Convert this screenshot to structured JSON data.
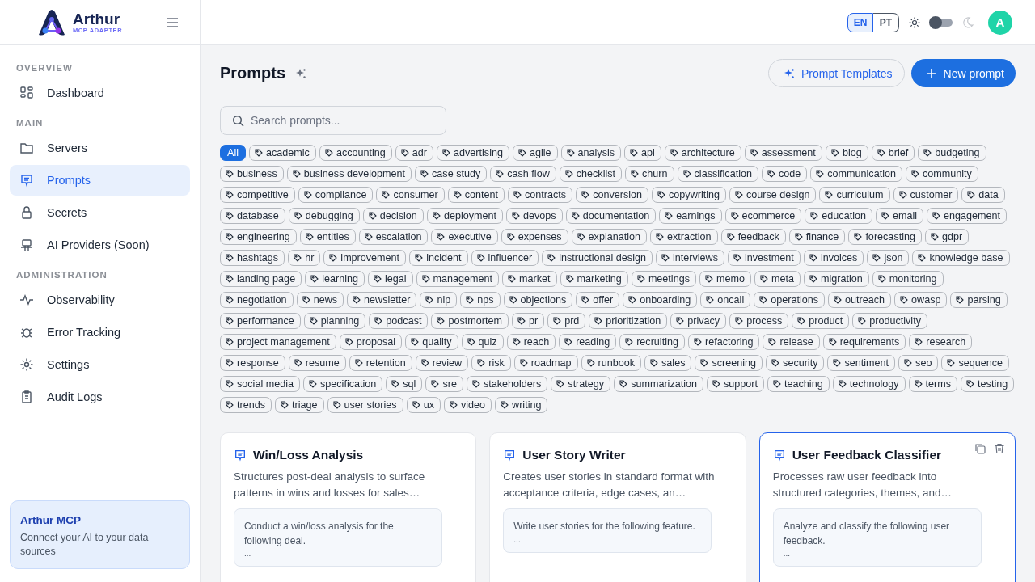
{
  "brand": {
    "name": "Arthur",
    "subtitle": "MCP ADAPTER"
  },
  "sidebar": {
    "sections": [
      {
        "title": "OVERVIEW",
        "items": [
          {
            "label": "Dashboard",
            "selected": false
          }
        ]
      },
      {
        "title": "MAIN",
        "items": [
          {
            "label": "Servers",
            "selected": false
          },
          {
            "label": "Prompts",
            "selected": true
          },
          {
            "label": "Secrets",
            "selected": false
          },
          {
            "label": "AI Providers (Soon)",
            "selected": false
          }
        ]
      },
      {
        "title": "ADMINISTRATION",
        "items": [
          {
            "label": "Observability",
            "selected": false
          },
          {
            "label": "Error Tracking",
            "selected": false
          },
          {
            "label": "Settings",
            "selected": false
          },
          {
            "label": "Audit Logs",
            "selected": false
          }
        ]
      }
    ],
    "promo": {
      "title": "Arthur MCP",
      "text": "Connect your AI to your data sources"
    }
  },
  "header": {
    "languages": [
      {
        "label": "EN",
        "selected": true
      },
      {
        "label": "PT",
        "selected": false
      }
    ],
    "dark_mode": false,
    "avatar": "A"
  },
  "page": {
    "title": "Prompts",
    "templates_button": "Prompt Templates",
    "new_button": "New prompt",
    "search": {
      "placeholder": "Search prompts..."
    }
  },
  "filters": [
    {
      "kind": "all",
      "label": "All",
      "selected": true
    },
    {
      "kind": "tag",
      "label": "academic",
      "selected": false
    },
    {
      "kind": "tag",
      "label": "accounting",
      "selected": false
    },
    {
      "kind": "tag",
      "label": "adr",
      "selected": false
    },
    {
      "kind": "tag",
      "label": "advertising",
      "selected": false
    },
    {
      "kind": "tag",
      "label": "agile",
      "selected": false
    },
    {
      "kind": "tag",
      "label": "analysis",
      "selected": false
    },
    {
      "kind": "tag",
      "label": "api",
      "selected": false
    },
    {
      "kind": "tag",
      "label": "architecture",
      "selected": false
    },
    {
      "kind": "tag",
      "label": "assessment",
      "selected": false
    },
    {
      "kind": "tag",
      "label": "blog",
      "selected": false
    },
    {
      "kind": "tag",
      "label": "brief",
      "selected": false
    },
    {
      "kind": "tag",
      "label": "budgeting",
      "selected": false
    },
    {
      "kind": "tag",
      "label": "business",
      "selected": false
    },
    {
      "kind": "tag",
      "label": "business development",
      "selected": false
    },
    {
      "kind": "tag",
      "label": "case study",
      "selected": false
    },
    {
      "kind": "tag",
      "label": "cash flow",
      "selected": false
    },
    {
      "kind": "tag",
      "label": "checklist",
      "selected": false
    },
    {
      "kind": "tag",
      "label": "churn",
      "selected": false
    },
    {
      "kind": "tag",
      "label": "classification",
      "selected": false
    },
    {
      "kind": "tag",
      "label": "code",
      "selected": false
    },
    {
      "kind": "tag",
      "label": "communication",
      "selected": false
    },
    {
      "kind": "tag",
      "label": "community",
      "selected": false
    },
    {
      "kind": "tag",
      "label": "competitive",
      "selected": false
    },
    {
      "kind": "tag",
      "label": "compliance",
      "selected": false
    },
    {
      "kind": "tag",
      "label": "consumer",
      "selected": false
    },
    {
      "kind": "tag",
      "label": "content",
      "selected": false
    },
    {
      "kind": "tag",
      "label": "contracts",
      "selected": false
    },
    {
      "kind": "tag",
      "label": "conversion",
      "selected": false
    },
    {
      "kind": "tag",
      "label": "copywriting",
      "selected": false
    },
    {
      "kind": "tag",
      "label": "course design",
      "selected": false
    },
    {
      "kind": "tag",
      "label": "curriculum",
      "selected": false
    },
    {
      "kind": "tag",
      "label": "customer",
      "selected": false
    },
    {
      "kind": "tag",
      "label": "data",
      "selected": false
    },
    {
      "kind": "tag",
      "label": "database",
      "selected": false
    },
    {
      "kind": "tag",
      "label": "debugging",
      "selected": false
    },
    {
      "kind": "tag",
      "label": "decision",
      "selected": false
    },
    {
      "kind": "tag",
      "label": "deployment",
      "selected": false
    },
    {
      "kind": "tag",
      "label": "devops",
      "selected": false
    },
    {
      "kind": "tag",
      "label": "documentation",
      "selected": false
    },
    {
      "kind": "tag",
      "label": "earnings",
      "selected": false
    },
    {
      "kind": "tag",
      "label": "ecommerce",
      "selected": false
    },
    {
      "kind": "tag",
      "label": "education",
      "selected": false
    },
    {
      "kind": "tag",
      "label": "email",
      "selected": false
    },
    {
      "kind": "tag",
      "label": "engagement",
      "selected": false
    },
    {
      "kind": "tag",
      "label": "engineering",
      "selected": false
    },
    {
      "kind": "tag",
      "label": "entities",
      "selected": false
    },
    {
      "kind": "tag",
      "label": "escalation",
      "selected": false
    },
    {
      "kind": "tag",
      "label": "executive",
      "selected": false
    },
    {
      "kind": "tag",
      "label": "expenses",
      "selected": false
    },
    {
      "kind": "tag",
      "label": "explanation",
      "selected": false
    },
    {
      "kind": "tag",
      "label": "extraction",
      "selected": false
    },
    {
      "kind": "tag",
      "label": "feedback",
      "selected": false
    },
    {
      "kind": "tag",
      "label": "finance",
      "selected": false
    },
    {
      "kind": "tag",
      "label": "forecasting",
      "selected": false
    },
    {
      "kind": "tag",
      "label": "gdpr",
      "selected": false
    },
    {
      "kind": "tag",
      "label": "hashtags",
      "selected": false
    },
    {
      "kind": "tag",
      "label": "hr",
      "selected": false
    },
    {
      "kind": "tag",
      "label": "improvement",
      "selected": false
    },
    {
      "kind": "tag",
      "label": "incident",
      "selected": false
    },
    {
      "kind": "tag",
      "label": "influencer",
      "selected": false
    },
    {
      "kind": "tag",
      "label": "instructional design",
      "selected": false
    },
    {
      "kind": "tag",
      "label": "interviews",
      "selected": false
    },
    {
      "kind": "tag",
      "label": "investment",
      "selected": false
    },
    {
      "kind": "tag",
      "label": "invoices",
      "selected": false
    },
    {
      "kind": "tag",
      "label": "json",
      "selected": false
    },
    {
      "kind": "tag",
      "label": "knowledge base",
      "selected": false
    },
    {
      "kind": "tag",
      "label": "landing page",
      "selected": false
    },
    {
      "kind": "tag",
      "label": "learning",
      "selected": false
    },
    {
      "kind": "tag",
      "label": "legal",
      "selected": false
    },
    {
      "kind": "tag",
      "label": "management",
      "selected": false
    },
    {
      "kind": "tag",
      "label": "market",
      "selected": false
    },
    {
      "kind": "tag",
      "label": "marketing",
      "selected": false
    },
    {
      "kind": "tag",
      "label": "meetings",
      "selected": false
    },
    {
      "kind": "tag",
      "label": "memo",
      "selected": false
    },
    {
      "kind": "tag",
      "label": "meta",
      "selected": false
    },
    {
      "kind": "tag",
      "label": "migration",
      "selected": false
    },
    {
      "kind": "tag",
      "label": "monitoring",
      "selected": false
    },
    {
      "kind": "tag",
      "label": "negotiation",
      "selected": false
    },
    {
      "kind": "tag",
      "label": "news",
      "selected": false
    },
    {
      "kind": "tag",
      "label": "newsletter",
      "selected": false
    },
    {
      "kind": "tag",
      "label": "nlp",
      "selected": false
    },
    {
      "kind": "tag",
      "label": "nps",
      "selected": false
    },
    {
      "kind": "tag",
      "label": "objections",
      "selected": false
    },
    {
      "kind": "tag",
      "label": "offer",
      "selected": false
    },
    {
      "kind": "tag",
      "label": "onboarding",
      "selected": false
    },
    {
      "kind": "tag",
      "label": "oncall",
      "selected": false
    },
    {
      "kind": "tag",
      "label": "operations",
      "selected": false
    },
    {
      "kind": "tag",
      "label": "outreach",
      "selected": false
    },
    {
      "kind": "tag",
      "label": "owasp",
      "selected": false
    },
    {
      "kind": "tag",
      "label": "parsing",
      "selected": false
    },
    {
      "kind": "tag",
      "label": "performance",
      "selected": false
    },
    {
      "kind": "tag",
      "label": "planning",
      "selected": false
    },
    {
      "kind": "tag",
      "label": "podcast",
      "selected": false
    },
    {
      "kind": "tag",
      "label": "postmortem",
      "selected": false
    },
    {
      "kind": "tag",
      "label": "pr",
      "selected": false
    },
    {
      "kind": "tag",
      "label": "prd",
      "selected": false
    },
    {
      "kind": "tag",
      "label": "prioritization",
      "selected": false
    },
    {
      "kind": "tag",
      "label": "privacy",
      "selected": false
    },
    {
      "kind": "tag",
      "label": "process",
      "selected": false
    },
    {
      "kind": "tag",
      "label": "product",
      "selected": false
    },
    {
      "kind": "tag",
      "label": "productivity",
      "selected": false
    },
    {
      "kind": "tag",
      "label": "project management",
      "selected": false
    },
    {
      "kind": "tag",
      "label": "proposal",
      "selected": false
    },
    {
      "kind": "tag",
      "label": "quality",
      "selected": false
    },
    {
      "kind": "tag",
      "label": "quiz",
      "selected": false
    },
    {
      "kind": "tag",
      "label": "reach",
      "selected": false
    },
    {
      "kind": "tag",
      "label": "reading",
      "selected": false
    },
    {
      "kind": "tag",
      "label": "recruiting",
      "selected": false
    },
    {
      "kind": "tag",
      "label": "refactoring",
      "selected": false
    },
    {
      "kind": "tag",
      "label": "release",
      "selected": false
    },
    {
      "kind": "tag",
      "label": "requirements",
      "selected": false
    },
    {
      "kind": "tag",
      "label": "research",
      "selected": false
    },
    {
      "kind": "tag",
      "label": "response",
      "selected": false
    },
    {
      "kind": "tag",
      "label": "resume",
      "selected": false
    },
    {
      "kind": "tag",
      "label": "retention",
      "selected": false
    },
    {
      "kind": "tag",
      "label": "review",
      "selected": false
    },
    {
      "kind": "tag",
      "label": "risk",
      "selected": false
    },
    {
      "kind": "tag",
      "label": "roadmap",
      "selected": false
    },
    {
      "kind": "tag",
      "label": "runbook",
      "selected": false
    },
    {
      "kind": "tag",
      "label": "sales",
      "selected": false
    },
    {
      "kind": "tag",
      "label": "screening",
      "selected": false
    },
    {
      "kind": "tag",
      "label": "security",
      "selected": false
    },
    {
      "kind": "tag",
      "label": "sentiment",
      "selected": false
    },
    {
      "kind": "tag",
      "label": "seo",
      "selected": false
    },
    {
      "kind": "tag",
      "label": "sequence",
      "selected": false
    },
    {
      "kind": "tag",
      "label": "social media",
      "selected": false
    },
    {
      "kind": "tag",
      "label": "specification",
      "selected": false
    },
    {
      "kind": "tag",
      "label": "sql",
      "selected": false
    },
    {
      "kind": "tag",
      "label": "sre",
      "selected": false
    },
    {
      "kind": "tag",
      "label": "stakeholders",
      "selected": false
    },
    {
      "kind": "tag",
      "label": "strategy",
      "selected": false
    },
    {
      "kind": "tag",
      "label": "summarization",
      "selected": false
    },
    {
      "kind": "tag",
      "label": "support",
      "selected": false
    },
    {
      "kind": "tag",
      "label": "teaching",
      "selected": false
    },
    {
      "kind": "tag",
      "label": "technology",
      "selected": false
    },
    {
      "kind": "tag",
      "label": "terms",
      "selected": false
    },
    {
      "kind": "tag",
      "label": "testing",
      "selected": false
    },
    {
      "kind": "tag",
      "label": "trends",
      "selected": false
    },
    {
      "kind": "tag",
      "label": "triage",
      "selected": false
    },
    {
      "kind": "tag",
      "label": "user stories",
      "selected": false
    },
    {
      "kind": "tag",
      "label": "ux",
      "selected": false
    },
    {
      "kind": "tag",
      "label": "video",
      "selected": false
    },
    {
      "kind": "tag",
      "label": "writing",
      "selected": false
    }
  ],
  "cards": [
    {
      "title": "Win/Loss Analysis",
      "description": "Structures post-deal analysis to surface patterns in wins and losses for sales…",
      "preview": [
        "Conduct a win/loss analysis for the following deal.",
        "..."
      ],
      "selected": false
    },
    {
      "title": "User Story Writer",
      "description": "Creates user stories in standard format with acceptance criteria, edge cases, an…",
      "preview": [
        "Write user stories for the following feature.",
        "..."
      ],
      "selected": false
    },
    {
      "title": "User Feedback Classifier",
      "description": "Processes raw user feedback into structured categories, themes, and…",
      "preview": [
        "Analyze and classify the following user feedback.",
        "..."
      ],
      "selected": true
    }
  ]
}
